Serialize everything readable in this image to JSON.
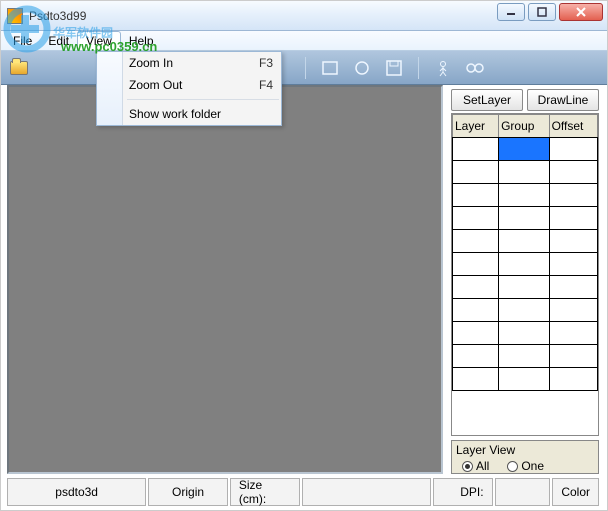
{
  "window": {
    "title": "Psdto3d99"
  },
  "menubar": {
    "file": "File",
    "edit": "Edit",
    "view": "View",
    "help": "Help"
  },
  "viewmenu": {
    "zoom_in": "Zoom In",
    "zoom_in_key": "F3",
    "zoom_out": "Zoom Out",
    "zoom_out_key": "F4",
    "show_folder": "Show work folder"
  },
  "right": {
    "tab_setlayer": "SetLayer",
    "tab_drawline": "DrawLine",
    "col_layer": "Layer",
    "col_group": "Group",
    "col_offset": "Offset",
    "layer_view_title": "Layer View",
    "radio_all": "All",
    "radio_one": "One"
  },
  "status": {
    "app": "psdto3d",
    "origin": "Origin",
    "size_label": "Size (cm):",
    "dpi_label": "DPI:",
    "color_label": "Color"
  },
  "watermark": {
    "text": "华军软件园",
    "url": "www.pc0359.cn"
  }
}
